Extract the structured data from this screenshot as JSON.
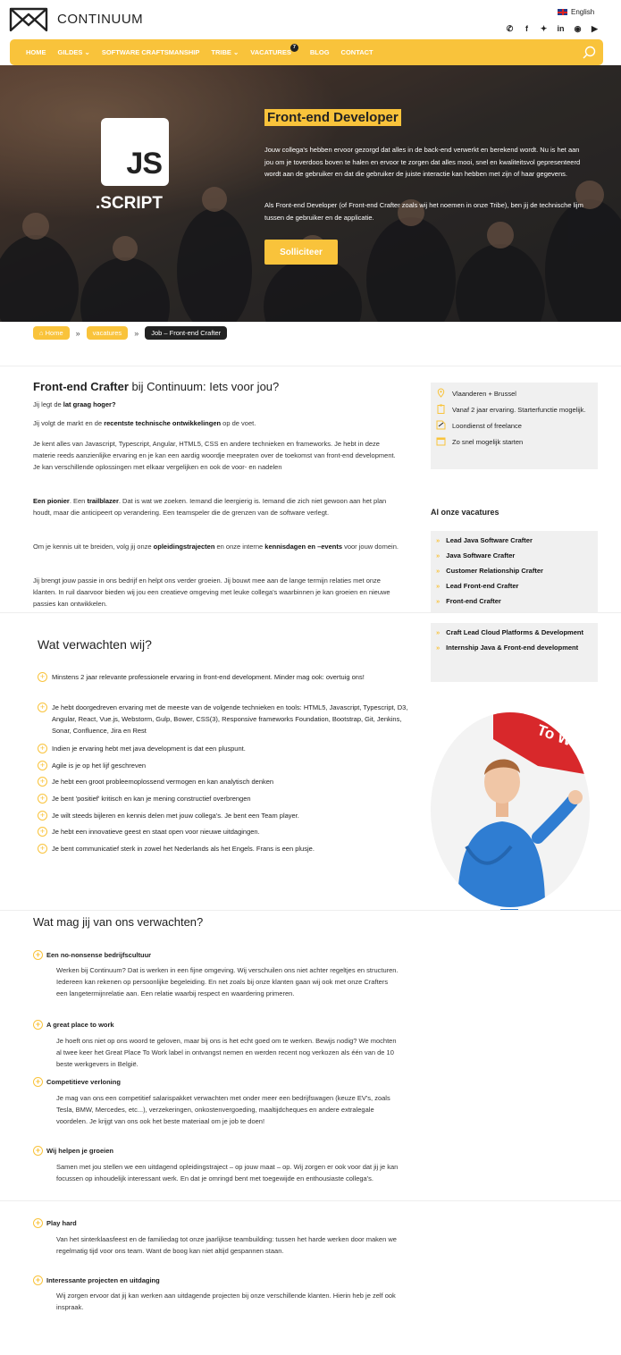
{
  "brand": {
    "name": "CONTINUUM"
  },
  "language": "English",
  "social": [
    "whatsapp-icon",
    "facebook-icon",
    "twitter-icon",
    "linkedin-icon",
    "instagram-icon",
    "youtube-icon"
  ],
  "nav": {
    "items": [
      "HOME",
      "GILDES",
      "SOFTWARE CRAFTSMANSHIP",
      "TRIBE",
      "VACATURES",
      "BLOG",
      "CONTACT"
    ],
    "vacatures_badge": "7"
  },
  "hero": {
    "logo_text": "JS",
    "logo_sub": ".SCRIPT",
    "title": "Front-end Developer",
    "p1": "Jouw collega's hebben ervoor gezorgd dat alles in de back-end verwerkt en berekend wordt. Nu is het aan jou om je toverdoos boven te halen en ervoor te zorgen dat alles mooi, snel en kwaliteitsvol gepresenteerd wordt aan de gebruiker en dat die gebruiker de juiste interactie kan hebben met zijn of haar gegevens.",
    "p2": "Als Front-end Developer (of Front-end Crafter zoals wij het noemen in onze Tribe), ben jij de technische lijm tussen de gebruiker en de applicatie.",
    "apply": "Solliciteer"
  },
  "breadcrumb": {
    "home": "Home",
    "sep": "»",
    "vacatures": "vacatures",
    "current": "Job – Front-end Crafter"
  },
  "intro": {
    "title_bold": "Front-end Crafter",
    "title_rest": " bij Continuum: Iets voor jou?",
    "p1_a": "Jij legt de ",
    "p1_b": "lat graag hoger?",
    "p2_a": "Jij volgt de markt en de ",
    "p2_b": "recentste technische ontwikkelingen",
    "p2_c": " op de voet.",
    "p3": "Je kent alles van Javascript, Typescript, Angular, HTML5, CSS en andere technieken en frameworks. Je hebt in deze materie reeds aanzienlijke ervaring en je kan een aardig woordje meepraten over de toekomst van front-end development. Je kan verschillende oplossingen met elkaar vergelijken en ook de voor- en nadelen",
    "p4_a": "Een pionier",
    "p4_b": ". Een ",
    "p4_c": "trailblazer",
    "p4_d": ". Dat is wat we zoeken. Iemand die leergierig is. Iemand die zich niet gewoon aan het plan houdt, maar die anticipeert op verandering. Een teamspeler die de grenzen van de software verlegt.",
    "p5_a": "Om je kennis uit te breiden, volg jij onze ",
    "p5_b": "opleidingstrajecten",
    "p5_c": " en onze interne ",
    "p5_d": "kennisdagen en –events",
    "p5_e": " voor jouw domein.",
    "p6": "Jij brengt jouw passie in ons bedrijf en helpt ons verder groeien. Jij bouwt mee aan de lange termijn relaties met onze klanten. In ruil daarvoor bieden wij jou een creatieve omgeving met leuke collega's waarbinnen je kan groeien en nieuwe passies kan ontwikkelen."
  },
  "info": [
    {
      "icon": "location-icon",
      "text": "Vlaanderen + Brussel"
    },
    {
      "icon": "clipboard-icon",
      "text": "Vanaf 2 jaar ervaring. Starterfunctie mogelijk."
    },
    {
      "icon": "contract-icon",
      "text": "Loondienst of freelance"
    },
    {
      "icon": "calendar-icon",
      "text": "Zo snel mogelijk starten"
    }
  ],
  "vacancies": {
    "title": "Al onze vacatures",
    "chevron": "»",
    "items": [
      "Lead Java Software Crafter",
      "Java Software Crafter",
      "Customer Relationship Crafter",
      "Lead Front-end Crafter",
      "Front-end Crafter",
      "Craft Lead Cloud Platforms & Development",
      "Internship Java & Front-end development"
    ]
  },
  "expect": {
    "title": "Wat verwachten wij?",
    "items": [
      "Minstens 2 jaar relevante professionele ervaring in front-end development. Minder mag ook: overtuig ons!",
      "Je hebt doorgedreven ervaring met de meeste van de volgende technieken en tools: HTML5, Javascript, Typescript, D3, Angular, React, Vue.js, Webstorm, Gulp, Bower, CSS(3), Responsive frameworks Foundation, Bootstrap, Git, Jenkins, Sonar, Confluence, Jira en Rest",
      "Indien je ervaring hebt met java development is dat een pluspunt.",
      "Agile is je op het lijf geschreven",
      "Je hebt een groot probleemoplossend vermogen en kan analytisch denken",
      "Je bent 'positief' kritisch en kan je mening constructief overbrengen",
      "Je wilt steeds bijleren en kennis delen met jouw collega's. Je bent een Team player.",
      "Je hebt een innovatieve geest en staat open voor nieuwe uitdagingen.",
      "Je bent communicatief sterk in zowel het Nederlands als het Engels. Frans is een plusje."
    ]
  },
  "photo_sign": "To Work",
  "offer": {
    "title": "Wat mag jij van ons verwachten?",
    "items": [
      {
        "h": "Een no-nonsense bedrijfscultuur",
        "p": "Werken bij Continuum? Dat is werken in een fijne omgeving. Wij verschuilen ons niet achter regeltjes en structuren. Iedereen kan rekenen op persoonlijke begeleiding. En net zoals bij onze klanten gaan wij ook met onze Crafters een langetermijnrelatie aan. Een relatie waarbij respect en waardering primeren."
      },
      {
        "h": "A great place to work",
        "p": "Je hoeft ons niet op ons woord te geloven, maar bij ons is het echt goed om te werken. Bewijs nodig? We mochten al twee keer het Great Place To Work label in ontvangst nemen en werden recent nog verkozen als één van de 10 beste werkgevers in België."
      },
      {
        "h": "Competitieve verloning",
        "p": "Je mag van ons een competitief salarispakket verwachten met onder meer een bedrijfswagen (keuze EV's, zoals Tesla, BMW, Mercedes, etc...), verzekeringen, onkostenvergoeding, maaltijdcheques en andere extralegale voordelen. Je krijgt van ons ook het beste materiaal om je job te doen!"
      },
      {
        "h": "Wij helpen je groeien",
        "p": "Samen met jou stellen we een uitdagend opleidingstraject – op jouw maat – op. Wij zorgen er ook voor dat jij je kan focussen op inhoudelijk interessant werk. En dat je omringd bent met toegewijde en enthousiaste collega's."
      },
      {
        "h": "Play hard",
        "p": "Van het sinterklaasfeest en de familiedag tot onze jaarlijkse teambuilding: tussen het harde werken door maken we regelmatig tijd voor ons team. Want de boog kan niet altijd gespannen staan."
      },
      {
        "h": "Interessante projecten en uitdaging",
        "p": "Wij zorgen ervoor dat jij kan werken aan uitdagende projecten bij onze verschillende klanten. Hierin heb je zelf ook inspraak."
      }
    ]
  },
  "colors": {
    "accent": "#f9c33b",
    "dark": "#222222"
  }
}
